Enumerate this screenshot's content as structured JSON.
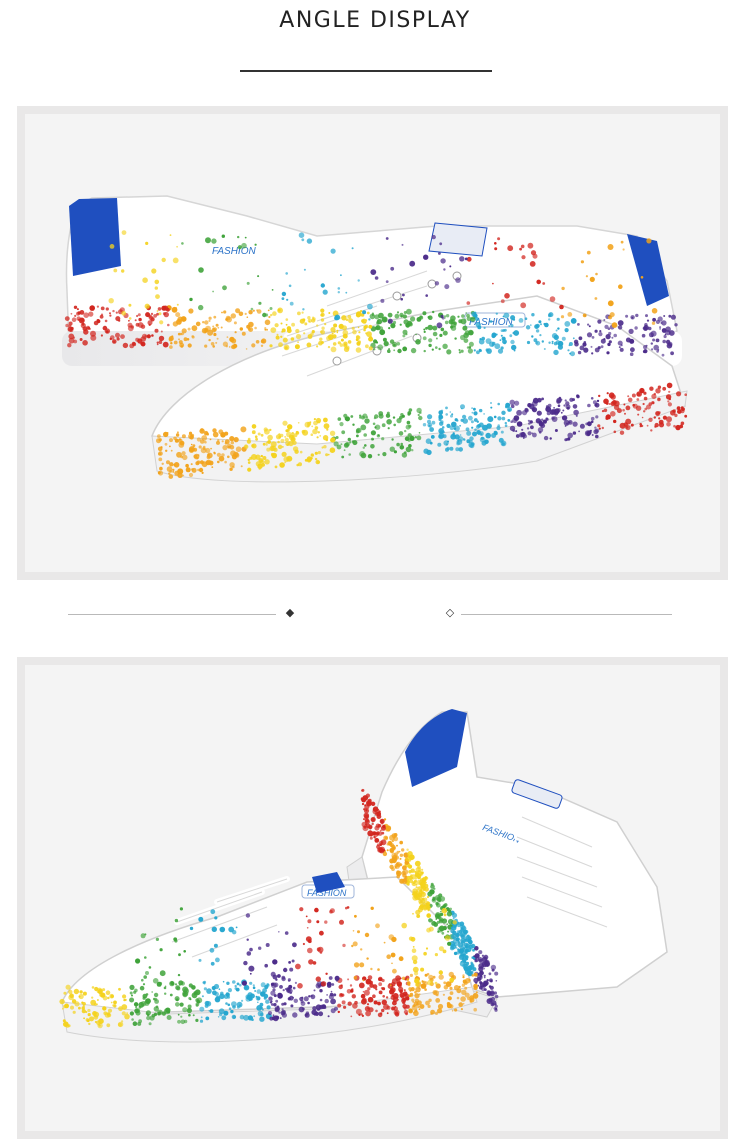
{
  "header": {
    "title": "ANGLE DISPLAY"
  },
  "divider": {
    "left_marker": "◆",
    "right_marker": "◇"
  },
  "photos": [
    {
      "name": "sneaker-pair-side-view",
      "shoe_brand_text": "FASHION",
      "upper_color": "#ffffff",
      "heel_color": "#1f4fbf",
      "splatter_colors": [
        "#d2261f",
        "#f2a31b",
        "#f4d21c",
        "#3fa33a",
        "#25a6cf",
        "#4b2b8a"
      ]
    },
    {
      "name": "sneaker-pair-angled-view",
      "shoe_brand_text": "FASHION",
      "upper_color": "#ffffff",
      "heel_color": "#1f4fbf",
      "splatter_colors": [
        "#d2261f",
        "#f2a31b",
        "#f4d21c",
        "#3fa33a",
        "#25a6cf",
        "#4b2b8a"
      ]
    }
  ]
}
